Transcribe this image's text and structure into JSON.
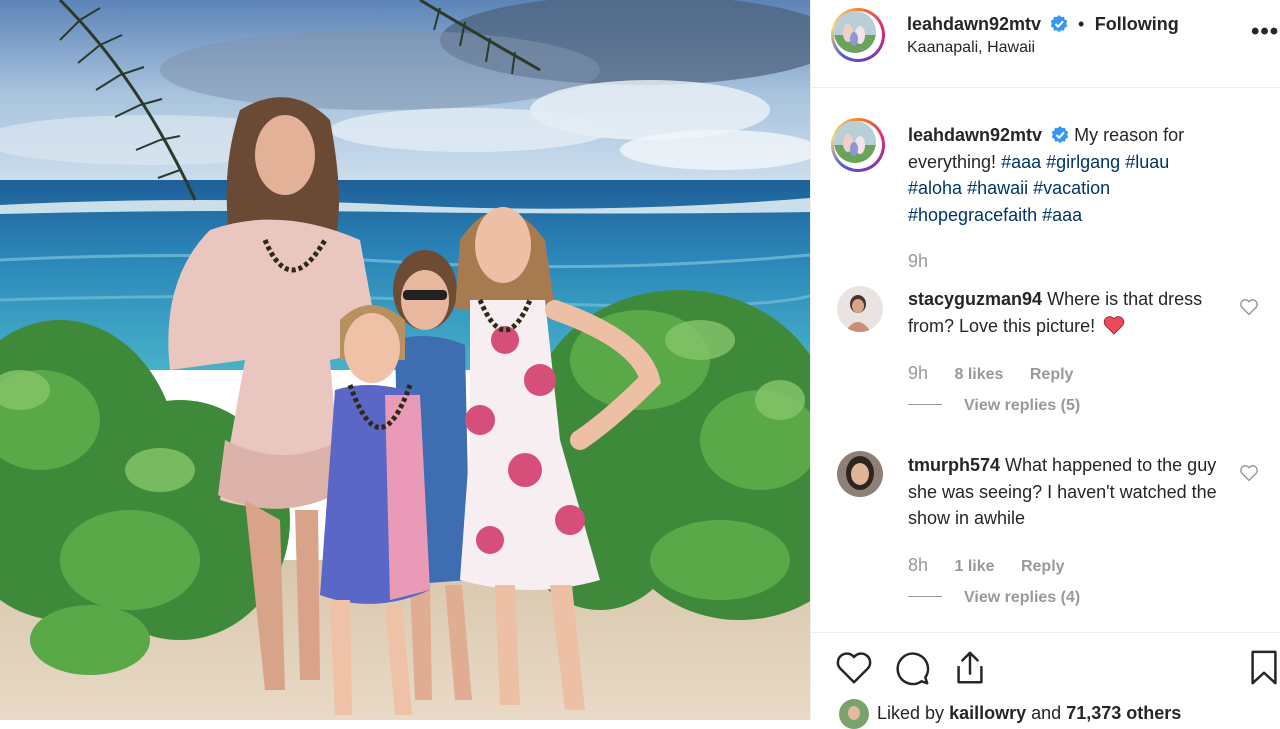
{
  "post": {
    "username": "leahdawn92mtv",
    "follow_status": "Following",
    "location": "Kaanapali, Hawaii",
    "more_label": "more-options",
    "caption": {
      "username": "leahdawn92mtv",
      "text": "My reason for everything!",
      "hashtags": [
        "#aaa",
        "#girlgang",
        "#luau",
        "#aloha",
        "#hawaii",
        "#vacation",
        "#hopegracefaith",
        "#aaa"
      ],
      "age": "9h"
    },
    "comments": [
      {
        "username": "stacyguzman94",
        "text": "Where is that dress from? Love this picture!",
        "emoji": "heart",
        "age": "9h",
        "likes": "8 likes",
        "reply_label": "Reply",
        "view_replies": "View replies (5)"
      },
      {
        "username": "tmurph574",
        "text": "What happened to the guy she was seeing? I haven't watched the show in awhile",
        "age": "8h",
        "likes": "1 like",
        "reply_label": "Reply",
        "view_replies": "View replies (4)"
      }
    ],
    "liked_by": {
      "prefix": "Liked by",
      "user": "kaillowry",
      "middle": "and",
      "count": "71,373 others"
    }
  },
  "colors": {
    "link": "#003569",
    "muted": "#999999",
    "verified": "#3897f0",
    "emoji_heart": "#ed4956"
  }
}
